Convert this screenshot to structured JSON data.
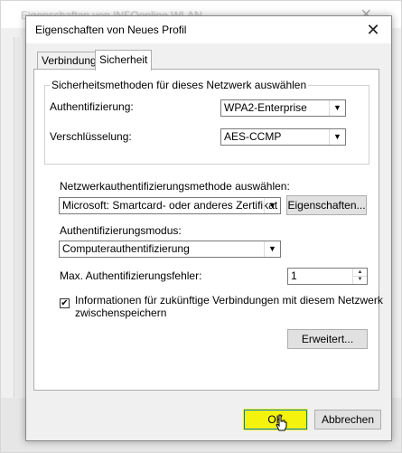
{
  "background_window": {
    "title": "Eigenschaften von INFOonline WLAN",
    "close_glyph": "✕"
  },
  "dialog": {
    "title": "Eigenschaften von Neues Profil",
    "close_glyph": "✕",
    "tabs": [
      {
        "label": "Verbindung",
        "active": false
      },
      {
        "label": "Sicherheit",
        "active": true
      }
    ],
    "security_group": {
      "legend": "Sicherheitsmethoden für dieses Netzwerk auswählen",
      "auth_label": "Authentifizierung:",
      "auth_value": "WPA2-Enterprise",
      "enc_label": "Verschlüsselung:",
      "enc_value": "AES-CCMP"
    },
    "eap_label": "Netzwerkauthentifizierungsmethode auswählen:",
    "eap_value": "Microsoft: Smartcard- oder anderes Zertifikat",
    "properties_button": "Eigenschaften...",
    "auth_mode_label": "Authentifizierungsmodus:",
    "auth_mode_value": "Computerauthentifizierung",
    "max_fail_label": "Max. Authentifizierungsfehler:",
    "max_fail_value": "1",
    "cache_checkbox_checked": true,
    "cache_checkbox_label_line1": "Informationen für zukünftige Verbindungen mit diesem Netzwerk",
    "cache_checkbox_label_line2": "zwischenspeichern",
    "advanced_button": "Erweitert...",
    "ok_button": "OK",
    "cancel_button": "Abbrechen",
    "dropdown_glyph": "▼",
    "check_glyph": "✔",
    "spin_up_glyph": "▲",
    "spin_down_glyph": "▼"
  },
  "colors": {
    "highlight": "#f2f200",
    "default_button_border": "#0078d7"
  }
}
